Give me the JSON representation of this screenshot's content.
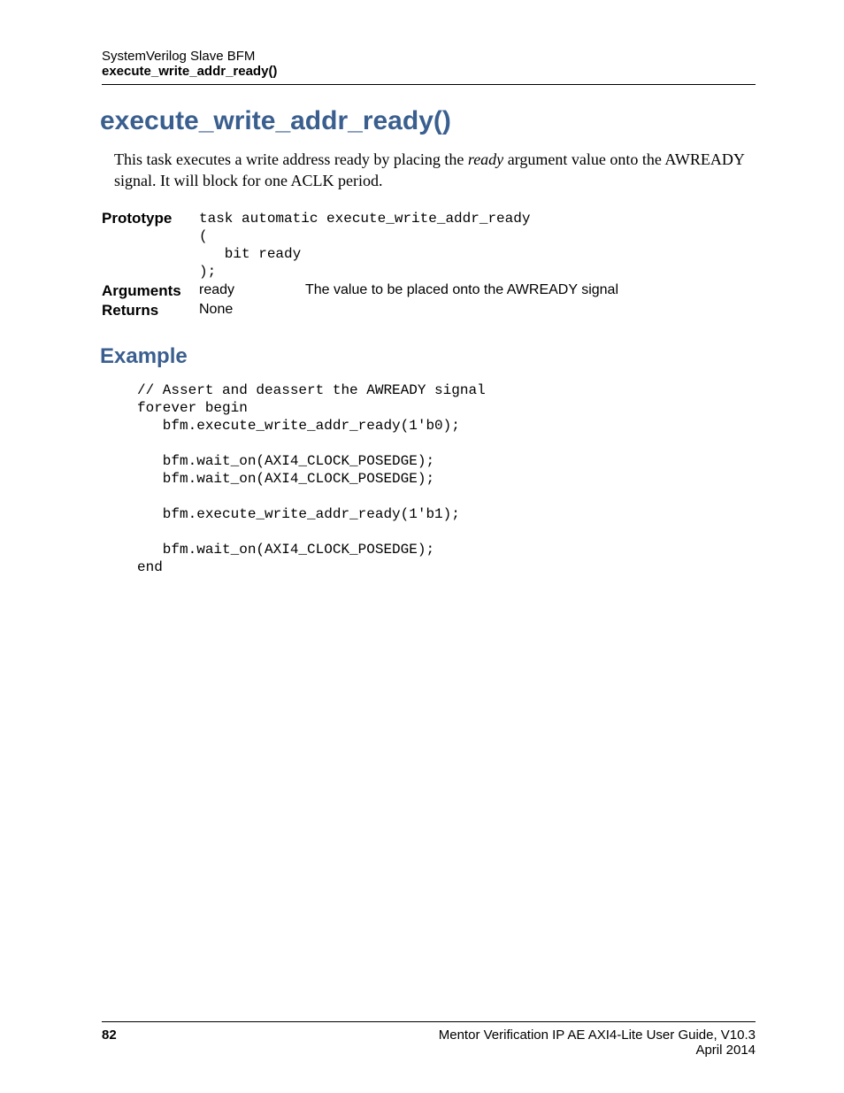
{
  "header": {
    "line1": "SystemVerilog Slave BFM",
    "line2": "execute_write_addr_ready()"
  },
  "title": "execute_write_addr_ready()",
  "body": {
    "part1": "This task executes a write address ready by placing the ",
    "italic": "ready",
    "part2": " argument value onto the AWREADY signal. It will block for one ACLK period."
  },
  "prototype": {
    "label": "Prototype",
    "code": "task automatic execute_write_addr_ready\n(\n   bit ready\n);"
  },
  "arguments": {
    "label": "Arguments",
    "name": "ready",
    "desc": "The value to be placed onto the AWREADY signal"
  },
  "returns": {
    "label": "Returns",
    "value": "None"
  },
  "example": {
    "heading": "Example",
    "code": "// Assert and deassert the AWREADY signal\nforever begin\n   bfm.execute_write_addr_ready(1'b0);\n\n   bfm.wait_on(AXI4_CLOCK_POSEDGE);\n   bfm.wait_on(AXI4_CLOCK_POSEDGE);\n\n   bfm.execute_write_addr_ready(1'b1);\n\n   bfm.wait_on(AXI4_CLOCK_POSEDGE);\nend"
  },
  "footer": {
    "page": "82",
    "guide": "Mentor Verification IP AE AXI4-Lite User Guide, V10.3",
    "date": "April 2014"
  }
}
